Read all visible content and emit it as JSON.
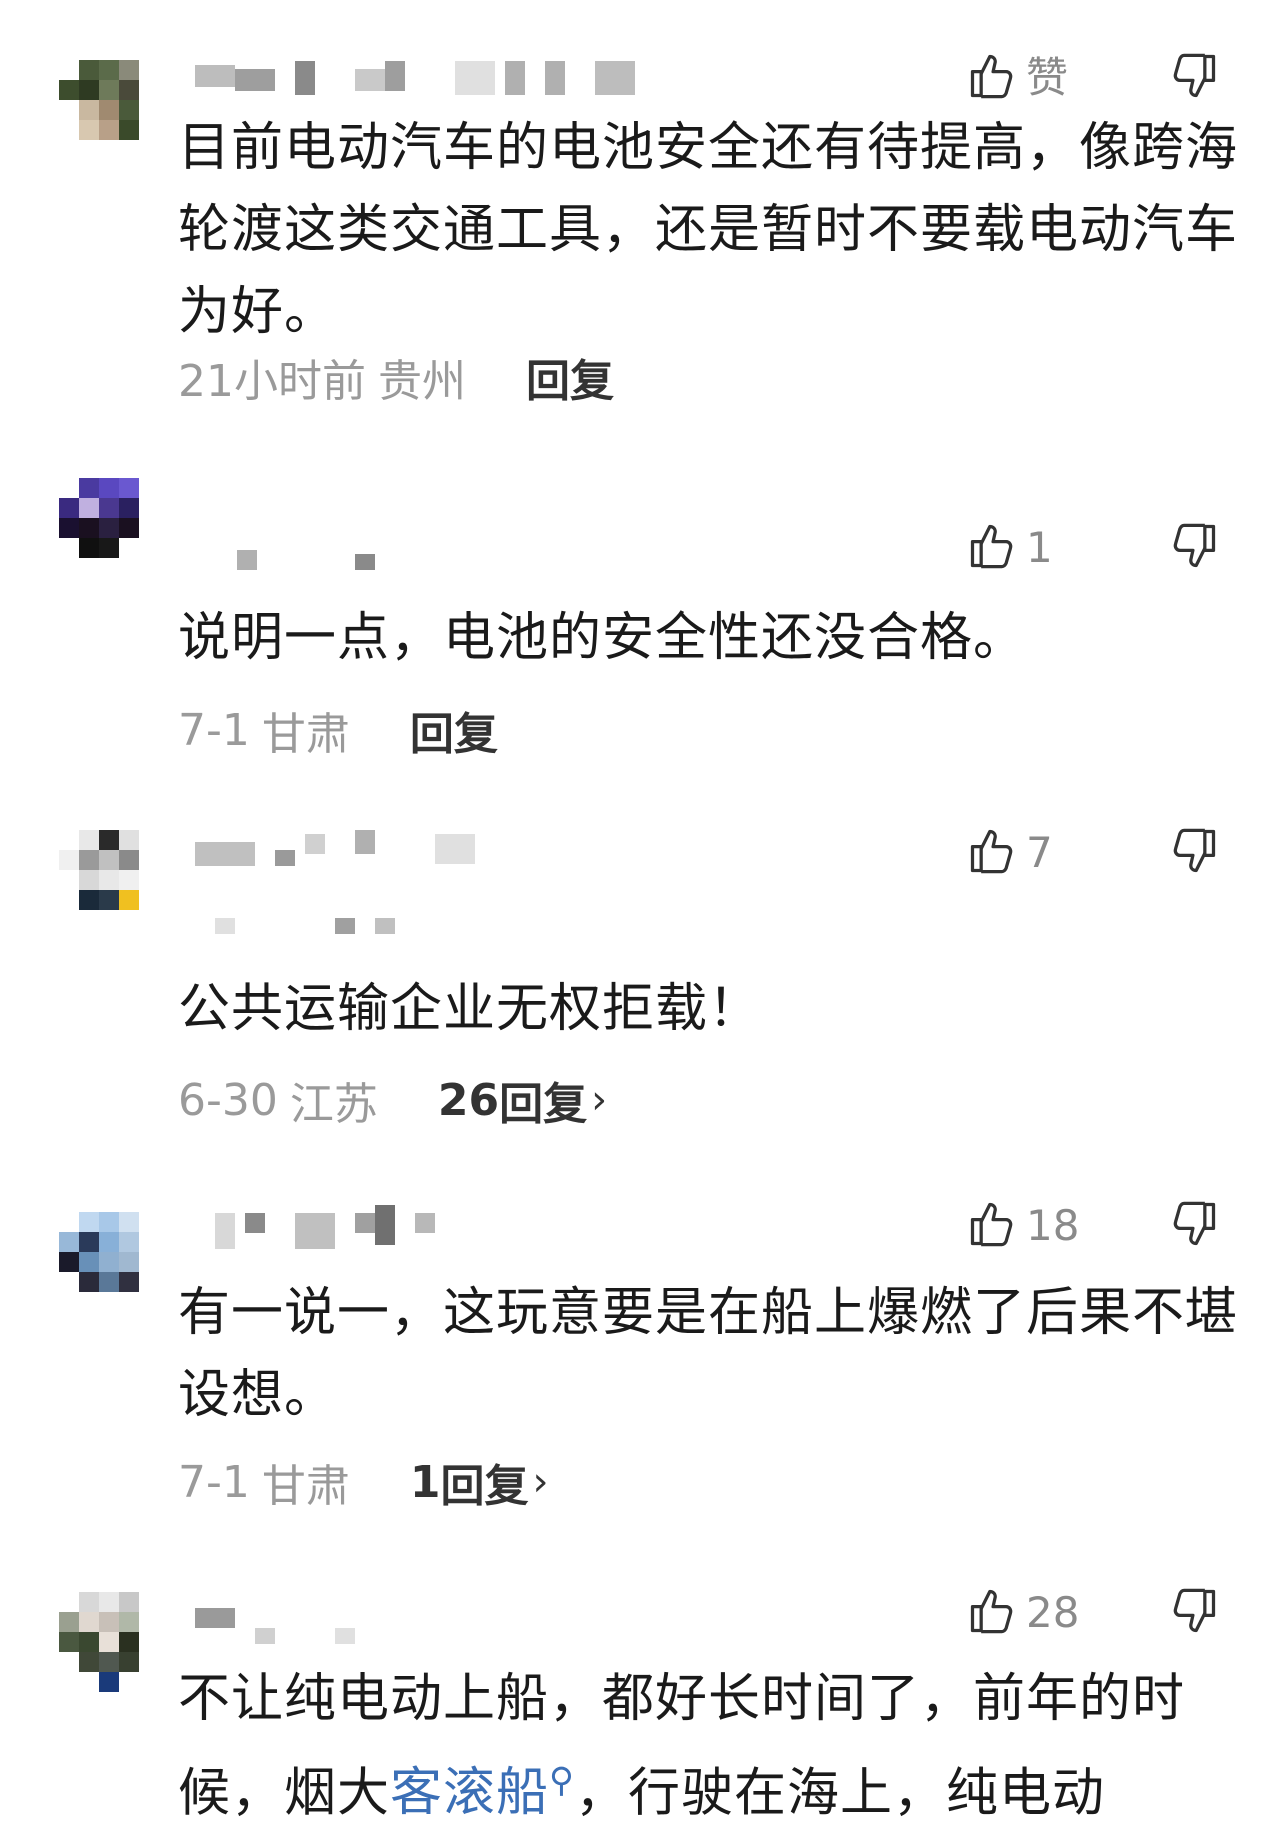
{
  "comments": [
    {
      "like_count": "赞",
      "text": "目前电动汽车的电池安全还有待提高，像跨海轮渡这类交通工具，还是暂时不要载电动汽车为好。",
      "time": "21小时前",
      "location": "贵州",
      "reply": "回复"
    },
    {
      "like_count": "1",
      "text": "说明一点，电池的安全性还没合格。",
      "time": "7-1",
      "location": "甘肃",
      "reply": "回复"
    },
    {
      "like_count": "7",
      "text": "公共运输企业无权拒载！",
      "time": "6-30",
      "location": "江苏",
      "reply_count": "26",
      "reply": "回复"
    },
    {
      "like_count": "18",
      "text": "有一说一，这玩意要是在船上爆燃了后果不堪设想。",
      "time": "7-1",
      "location": "甘肃",
      "reply_count": "1",
      "reply": "回复"
    },
    {
      "like_count": "28",
      "text_before_link": "不让纯电动上船，都好长时间了，前年的时候，烟大",
      "link_text": "客滚船",
      "text_after_link": "，行驶在海上，纯电动"
    }
  ],
  "icons": {
    "like": "thumbs-up-icon",
    "dislike": "thumbs-down-icon",
    "search": "search-icon"
  },
  "colors": {
    "text": "#1a1a1a",
    "meta": "#9a9a9a",
    "link": "#3b6fb6"
  }
}
